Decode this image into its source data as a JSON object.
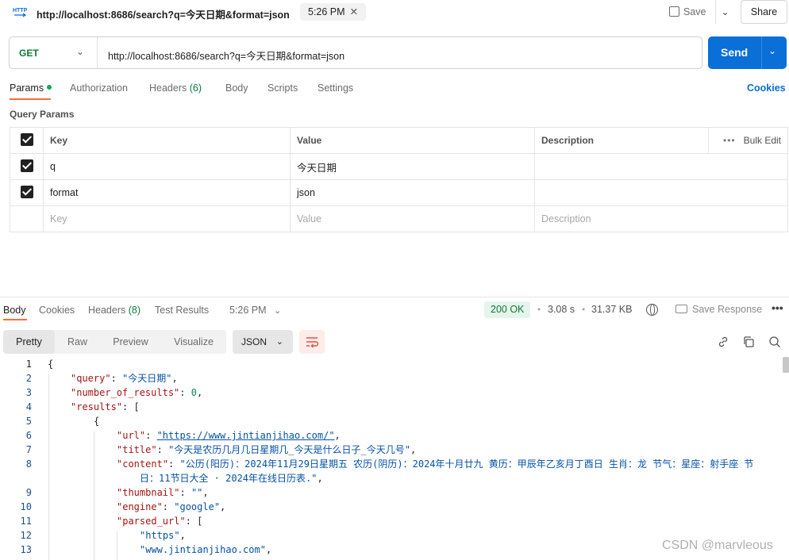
{
  "header": {
    "icon_text": "HTTP",
    "title": "http://localhost:8686/search?q=今天日期&format=json",
    "time_tab": "5:26 PM",
    "save_label": "Save",
    "share_label": "Share"
  },
  "request": {
    "method": "GET",
    "url": "http://localhost:8686/search?q=今天日期&format=json",
    "send_label": "Send"
  },
  "req_tabs": {
    "params": "Params",
    "authorization": "Authorization",
    "headers": "Headers",
    "headers_count": "(6)",
    "body": "Body",
    "scripts": "Scripts",
    "settings": "Settings",
    "cookies": "Cookies"
  },
  "query_params": {
    "label": "Query Params",
    "col_key": "Key",
    "col_value": "Value",
    "col_description": "Description",
    "bulk_edit": "Bulk Edit",
    "rows": [
      {
        "key": "q",
        "value": "今天日期",
        "description": ""
      },
      {
        "key": "format",
        "value": "json",
        "description": ""
      }
    ],
    "placeholder": {
      "key": "Key",
      "value": "Value",
      "description": "Description"
    }
  },
  "response": {
    "tabs": {
      "body": "Body",
      "cookies": "Cookies",
      "headers": "Headers",
      "headers_count": "(8)",
      "test_results": "Test Results",
      "time": "5:26 PM"
    },
    "status": "200 OK",
    "duration": "3.08 s",
    "size": "31.37 KB",
    "save_response": "Save Response",
    "views": {
      "pretty": "Pretty",
      "raw": "Raw",
      "preview": "Preview",
      "visualize": "Visualize"
    },
    "format": "JSON"
  },
  "code_lines": [
    {
      "num": "1"
    },
    {
      "num": "2",
      "key": "\"query\"",
      "val": "\"今天日期\""
    },
    {
      "num": "3",
      "key": "\"number_of_results\"",
      "val": "0"
    },
    {
      "num": "4",
      "key": "\"results\"",
      "val": "["
    },
    {
      "num": "5",
      "val": "{"
    },
    {
      "num": "6",
      "key": "\"url\"",
      "val": "\"https://www.jintianjihao.com/\""
    },
    {
      "num": "7",
      "key": "\"title\"",
      "val": "\"今天是农历几月几日星期几_今天是什么日子_今天几号\""
    },
    {
      "num": "8",
      "key": "\"content\"",
      "val": "\"公历(阳历)：2024年11月29日星期五 农历(阴历)：2024年十月廿九 黄历：甲辰年乙亥月丁酉日 生肖：龙 节气：星座：射手座 节",
      "val2": "日：11节日大全 · 2024年在线日历表.\""
    },
    {
      "num": "9",
      "key": "\"thumbnail\"",
      "val": "\"\""
    },
    {
      "num": "10",
      "key": "\"engine\"",
      "val": "\"google\""
    },
    {
      "num": "11",
      "key": "\"parsed_url\"",
      "val": "["
    },
    {
      "num": "12",
      "val": "\"https\""
    },
    {
      "num": "13",
      "val": "\"www.jintianjihao.com\""
    }
  ],
  "watermark": "CSDN @marvleous"
}
